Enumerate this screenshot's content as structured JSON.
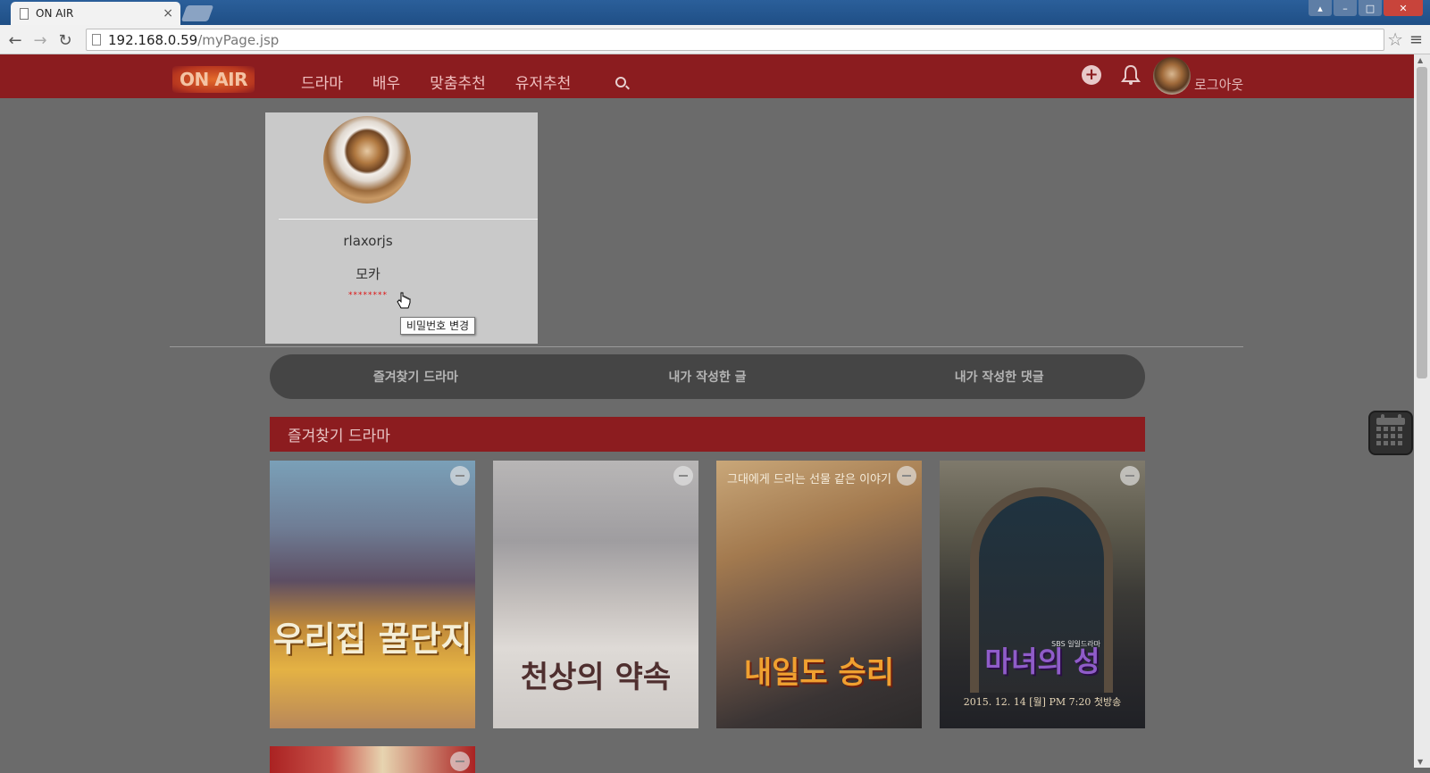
{
  "browser": {
    "tab_title": "ON AIR",
    "url_host": "192.168.0.59",
    "url_path": "/myPage.jsp"
  },
  "header": {
    "logo": "ON AIR",
    "nav": [
      "드라마",
      "배우",
      "맞춤추천",
      "유저추천"
    ],
    "logout": "로그아웃"
  },
  "profile": {
    "user_id": "rlaxorjs",
    "nickname": "모카",
    "password_mask": "********",
    "tooltip": "비밀번호 변경"
  },
  "subtabs": [
    "즐겨찾기 드라마",
    "내가 작성한 글",
    "내가 작성한 댓글"
  ],
  "favorites": {
    "title": "즐겨찾기 드라마",
    "posters": [
      {
        "title": "우리집 꿀단지"
      },
      {
        "title": "천상의 약속"
      },
      {
        "title": "내일도 승리",
        "tagline": "그대에게 드리는 선물 같은 이야기"
      },
      {
        "title": "마녀의 성",
        "badge": "SBS 일일드라마",
        "airdate": "2015. 12. 14 [월] PM 7:20 첫방송"
      }
    ]
  },
  "icons": {
    "plus": "plus-circle-icon",
    "bell": "bell-icon",
    "search": "search-icon",
    "calendar": "calendar-icon"
  },
  "colors": {
    "brand_red": "#8b1c1f",
    "page_bg": "#6b6b6b",
    "subtab_bg": "#454545"
  }
}
